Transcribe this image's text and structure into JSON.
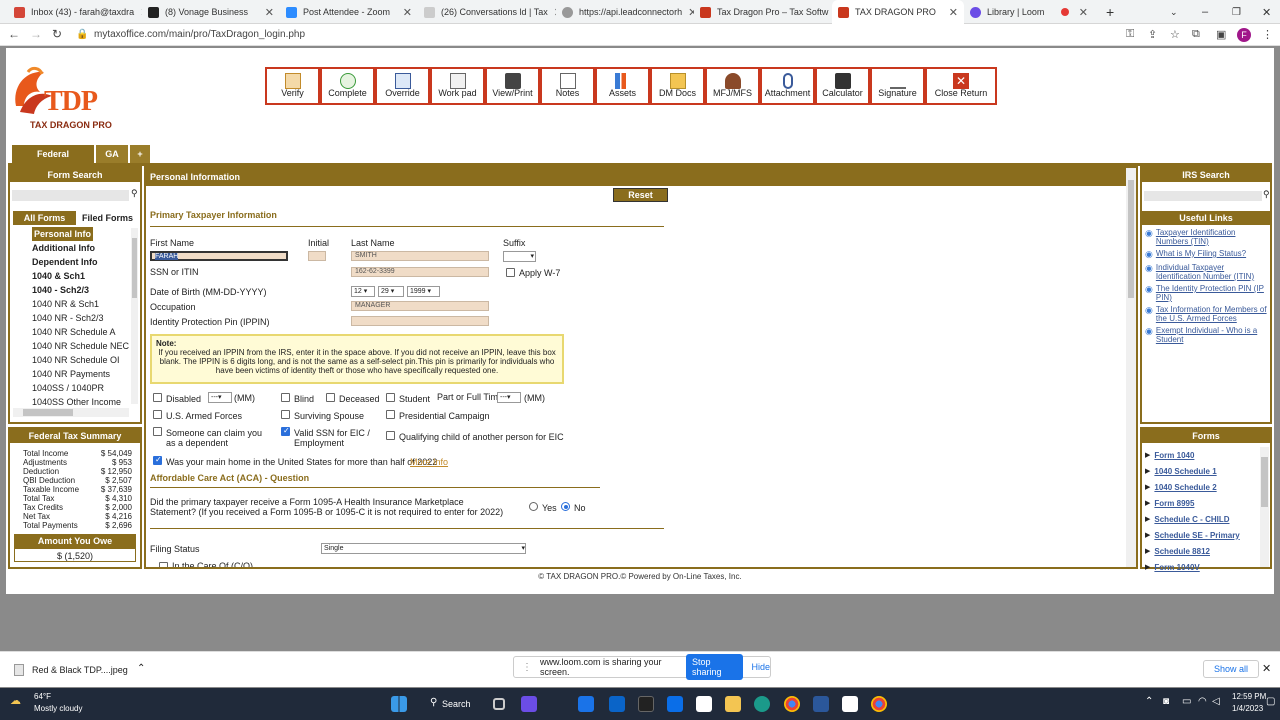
{
  "browser": {
    "tabs": [
      {
        "label": "Inbox (43) - farah@taxdra",
        "color": "#d44638"
      },
      {
        "label": "(8) Vonage Business",
        "color": "#222222"
      },
      {
        "label": "Post Attendee - Zoom",
        "color": "#2d8cff"
      },
      {
        "label": "(26) Conversations ld | Tax",
        "color": "#888888"
      },
      {
        "label": "https://api.leadconnectorh",
        "color": "#666666"
      },
      {
        "label": "Tax Dragon Pro – Tax Softw",
        "color": "#c9381e"
      },
      {
        "label": "TAX DRAGON PRO",
        "color": "#c9381e"
      },
      {
        "label": "Library | Loom",
        "color": "#6b4de6"
      }
    ],
    "url": "mytaxoffice.com/main/pro/TaxDragon_login.php",
    "profile_initial": "F"
  },
  "logo": {
    "line1": "TDP",
    "line2": "TAX DRAGON PRO"
  },
  "toolbar": [
    "Verify",
    "Complete",
    "Override",
    "Work pad",
    "View/Print",
    "Notes",
    "Assets",
    "DM Docs",
    "MFJ/MFS",
    "Attachment",
    "Calculator",
    "Signature",
    "Close Return"
  ],
  "state_tabs": [
    "Federal",
    "GA",
    "+"
  ],
  "left": {
    "title": "Form Search",
    "all_forms": "All Forms",
    "filed_forms": "Filed Forms",
    "items": [
      "Personal Info",
      "Additional Info",
      "Dependent Info",
      "1040 & Sch1",
      "1040 - Sch2/3",
      "1040 NR & Sch1",
      "1040 NR - Sch2/3",
      "1040 NR Schedule A",
      "1040 NR Schedule NEC",
      "1040 NR Schedule OI",
      "1040 NR Payments",
      "1040SS / 1040PR",
      "1040SS Other Income"
    ]
  },
  "summary": {
    "title": "Federal Tax Summary",
    "rows": [
      [
        "Total Income",
        "$ 54,049"
      ],
      [
        "Adjustments",
        "$ 953"
      ],
      [
        "Deduction",
        "$ 12,950"
      ],
      [
        "QBI Deduction",
        "$ 2,507"
      ],
      [
        "Taxable Income",
        "$ 37,639"
      ],
      [
        "Total Tax",
        "$ 4,310"
      ],
      [
        "Tax Credits",
        "$ 2,000"
      ],
      [
        "Net Tax",
        "$ 4,216"
      ],
      [
        "Total Payments",
        "$ 2,696"
      ]
    ],
    "owe_label": "Amount You Owe",
    "owe_value": "$ (1,520)"
  },
  "main": {
    "title": "Personal Information",
    "reset": "Reset Screen",
    "section1": "Primary Taxpayer Information",
    "first_name_label": "First Name",
    "initial_label": "Initial",
    "last_name_label": "Last Name",
    "suffix_label": "Suffix",
    "first_name": "FARAH",
    "last_name": "SMITH",
    "ssn_label": "SSN or ITIN",
    "ssn": "162-62-3399",
    "apply_w7": "Apply W-7",
    "dob_label": "Date of Birth (MM-DD-YYYY)",
    "dob_m": "12",
    "dob_d": "29",
    "dob_y": "1999",
    "occupation_label": "Occupation",
    "occupation": "MANAGER",
    "ippin_label": "Identity Protection Pin (IPPIN)",
    "note_title": "Note:",
    "note": "If you received an IPPIN from the IRS, enter it in the space above. If you did not receive an IPPIN, leave this box blank. The IPPIN is 6 digits long, and is not the same as a self-select pin.This pin is primarily for individuals who have been victims of identity theft or those who have specifically requested one.",
    "disabled": "Disabled",
    "mm": "(MM)",
    "dash": "---",
    "blind": "Blind",
    "deceased": "Deceased",
    "student": "Student",
    "parttime": "Part or Full Time",
    "armed": "U.S. Armed Forces",
    "surviving": "Surviving Spouse",
    "presidential": "Presidential Campaign",
    "claim": "Someone can claim you as a dependent",
    "validssn": "Valid SSN for EIC / Employment",
    "qualifying": "Qualifying child of another person for EIC",
    "mainhome": "Was your main home in the United States for more than half of 2022",
    "moreinfo": "More Info",
    "aca_title": "Affordable Care Act (ACA) - Question",
    "aca_q": "Did the primary taxpayer receive a Form 1095-A Health Insurance Marketplace Statement? (If you received a Form 1095-B or 1095-C it is not required to enter for 2022)",
    "yes": "Yes",
    "no": "No",
    "filing_label": "Filing Status",
    "filing_value": "Single",
    "careof": "In the Care Of (C/O)"
  },
  "right": {
    "irs_title": "IRS Search",
    "links_title": "Useful Links",
    "links": [
      "Taxpayer Identification Numbers (TIN)",
      "What is My Filing Status?",
      "Individual Taxpayer Identification Number (ITIN)",
      "The Identity Protection PIN (IP PIN)",
      "Tax Information for Members of the U.S. Armed Forces",
      "Exempt Individual - Who is a Student"
    ],
    "forms_title": "Forms",
    "forms": [
      "Form 1040",
      "1040 Schedule 1",
      "1040 Schedule 2",
      "Form 8995",
      "Schedule C - CHILD",
      "Schedule SE - Primary",
      "Schedule 8812",
      "Form 1040V"
    ]
  },
  "footer": "© TAX DRAGON PRO.© Powered by On-Line Taxes, Inc.",
  "download": {
    "file": "Red & Black TDP....jpeg",
    "show_all": "Show all"
  },
  "share": {
    "text": "www.loom.com is sharing your screen.",
    "stop": "Stop sharing",
    "hide": "Hide"
  },
  "taskbar": {
    "temp": "64°F",
    "weather": "Mostly cloudy",
    "search": "Search",
    "time": "12:59 PM",
    "date": "1/4/2023"
  }
}
